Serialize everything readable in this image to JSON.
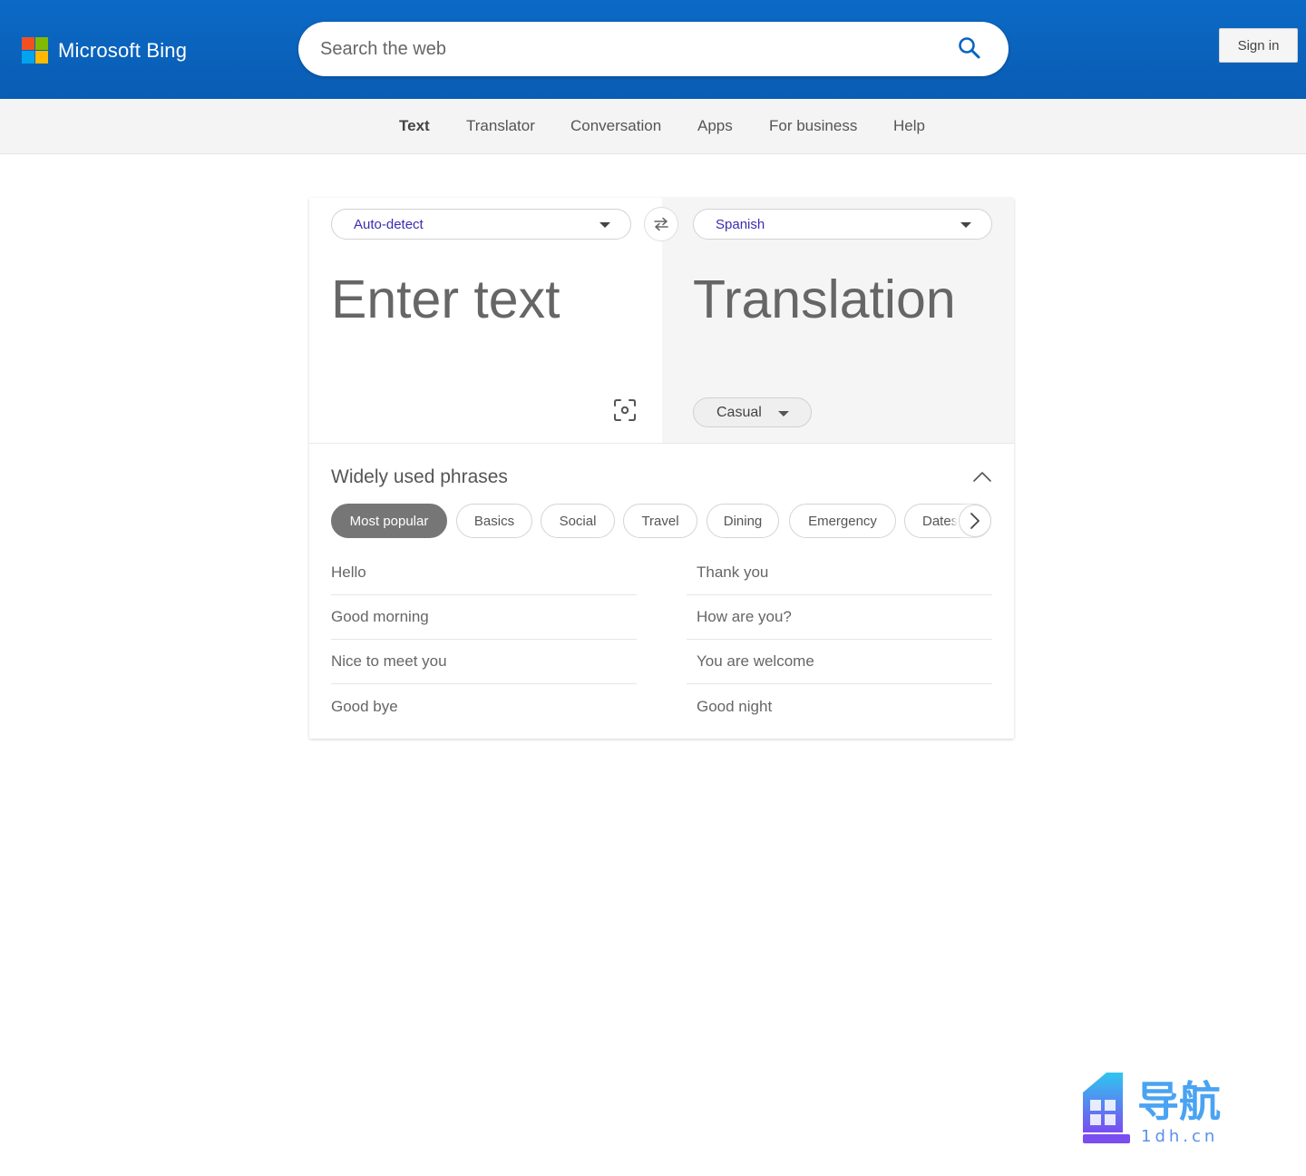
{
  "header": {
    "brand": "Microsoft Bing",
    "search_placeholder": "Search the web",
    "signin_label": "Sign in",
    "logo_colors": [
      "#f25022",
      "#7fba00",
      "#00a4ef",
      "#ffb900"
    ]
  },
  "nav": {
    "items": [
      {
        "label": "Text",
        "active": true
      },
      {
        "label": "Translator"
      },
      {
        "label": "Conversation"
      },
      {
        "label": "Apps"
      },
      {
        "label": "For business"
      },
      {
        "label": "Help"
      }
    ]
  },
  "translator": {
    "source_language": "Auto-detect",
    "target_language": "Spanish",
    "input_placeholder": "Enter text",
    "output_placeholder": "Translation",
    "tone": "Casual",
    "accent_color": "#3b2db0"
  },
  "phrases": {
    "title": "Widely used phrases",
    "categories": [
      {
        "label": "Most popular",
        "active": true
      },
      {
        "label": "Basics"
      },
      {
        "label": "Social"
      },
      {
        "label": "Travel"
      },
      {
        "label": "Dining"
      },
      {
        "label": "Emergency"
      },
      {
        "label": "Dates"
      }
    ],
    "left": [
      "Hello",
      "Good morning",
      "Nice to meet you",
      "Good bye"
    ],
    "right": [
      "Thank you",
      "How are you?",
      "You are welcome",
      "Good night"
    ]
  },
  "watermark": {
    "text": "导航",
    "subtext": "1dh.cn"
  }
}
